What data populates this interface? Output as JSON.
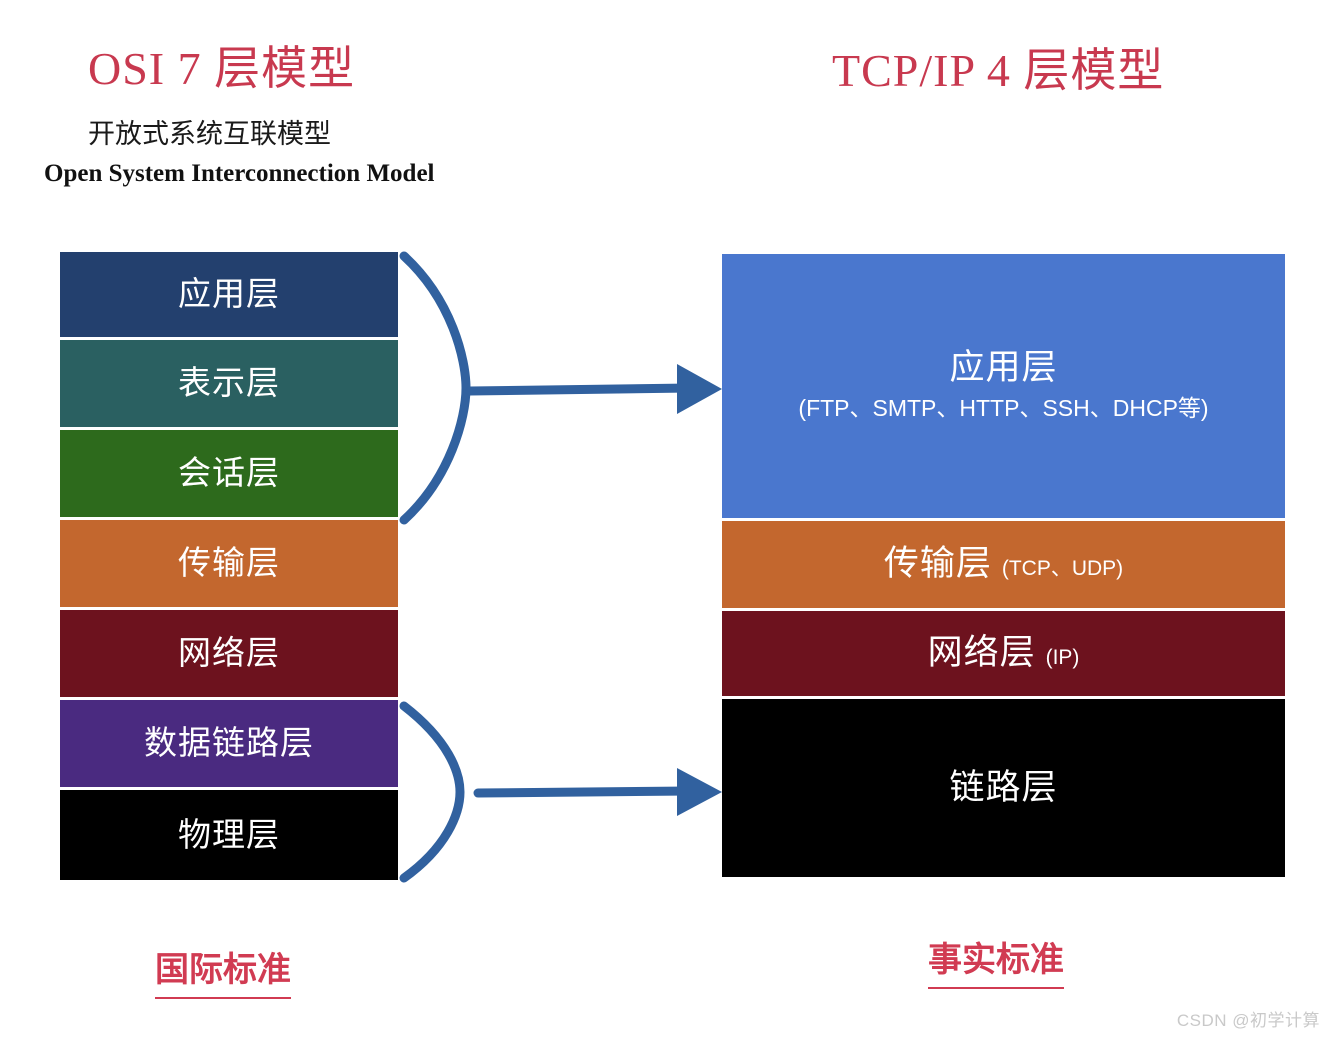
{
  "titles": {
    "osi": "OSI  7 层模型",
    "osi_subtitle_cn": "开放式系统互联模型",
    "osi_subtitle_en": "Open System Interconnection Model",
    "tcpip": "TCP/IP 4 层模型"
  },
  "osi_stack": {
    "layers": [
      {
        "label": "应用层",
        "color": "#23406e"
      },
      {
        "label": "表示层",
        "color": "#2a6061"
      },
      {
        "label": "会话层",
        "color": "#2d6a1c"
      },
      {
        "label": "传输层",
        "color": "#c3672e"
      },
      {
        "label": "网络层",
        "color": "#6d121e"
      },
      {
        "label": "数据链路层",
        "color": "#4a2a80"
      },
      {
        "label": "物理层",
        "color": "#000000"
      }
    ]
  },
  "tcpip_stack": {
    "layers": [
      {
        "label": "应用层",
        "detail": "(FTP、SMTP、HTTP、SSH、DHCP等)",
        "detail_position": "below",
        "color": "#4a77ce"
      },
      {
        "label": "传输层",
        "detail": "(TCP、UDP)",
        "detail_position": "inline",
        "color": "#c3672e"
      },
      {
        "label": "网络层",
        "detail": "(IP)",
        "detail_position": "inline",
        "color": "#6d121e"
      },
      {
        "label": "链路层",
        "detail": "",
        "detail_position": "none",
        "color": "#000000"
      }
    ]
  },
  "connectors": {
    "upper": {
      "name": "brace-arrow-upper",
      "from": "OSI 应用层/表示层/会话层",
      "to": "TCP/IP 应用层"
    },
    "lower": {
      "name": "brace-arrow-lower",
      "from": "OSI 数据链路层/物理层",
      "to": "TCP/IP 链路层"
    },
    "color": "#31619f"
  },
  "footnotes": {
    "left": "国际标准",
    "right": "事实标准"
  },
  "watermark": "CSDN @初学计算",
  "colors": {
    "title_red": "#c8394f",
    "footnote_red": "#d13b52",
    "arrow_blue": "#31619f",
    "white": "#ffffff"
  }
}
